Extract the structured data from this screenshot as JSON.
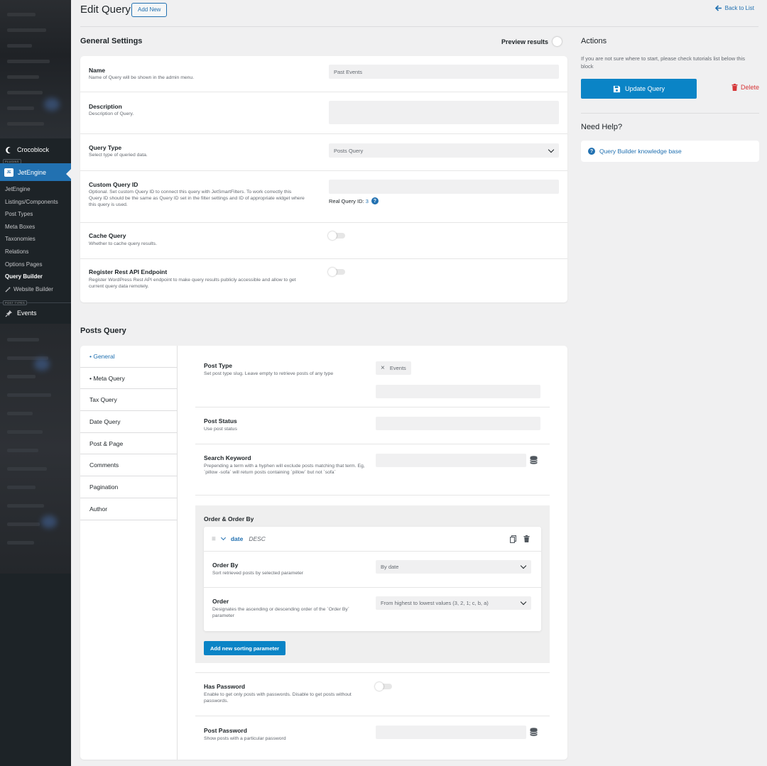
{
  "sidebar": {
    "plugins_tag": "PLUGINS",
    "crocoblock": "Crocoblock",
    "jetengine": "JetEngine",
    "jetengine_logo": "JE",
    "submenu": [
      "JetEngine",
      "Listings/Components",
      "Post Types",
      "Meta Boxes",
      "Taxonomies",
      "Relations",
      "Options Pages",
      "Query Builder",
      "Website Builder"
    ],
    "post_types_tag": "POST TYPES",
    "events": "Events"
  },
  "header": {
    "title": "Edit Query",
    "add_new": "Add New",
    "back": "Back to List"
  },
  "general": {
    "title": "General Settings",
    "preview_label": "Preview results",
    "fields": {
      "name": {
        "label": "Name",
        "desc": "Name of Query will be shown in the admin menu.",
        "value": "Past Events"
      },
      "description": {
        "label": "Description",
        "desc": "Description of Query.",
        "value": ""
      },
      "query_type": {
        "label": "Query Type",
        "desc": "Select type of queried data.",
        "value": "Posts Query"
      },
      "custom_id": {
        "label": "Custom Query ID",
        "desc": "Optional. Set custom Query ID to connect this query with JetSmartFilters. To work correctly this Query ID should be the same as Query ID set in the filter settings and ID of appropriate widget where this query is used.",
        "real_label": "Real Query ID:",
        "real_value": "3"
      },
      "cache": {
        "label": "Cache Query",
        "desc": "Whether to cache query results."
      },
      "rest": {
        "label": "Register Rest API Endpoint",
        "desc": "Register WordPress Rest API endpoint to make query results publicly accessible and allow to get current query data remotely."
      }
    }
  },
  "actions": {
    "title": "Actions",
    "desc": "If you are not sure where to start, please check tutorials list below this block",
    "update": "Update Query",
    "delete": "Delete"
  },
  "help": {
    "title": "Need Help?",
    "link": "Query Builder knowledge base"
  },
  "posts_query": {
    "title": "Posts Query",
    "tabs": [
      "• General",
      "• Meta Query",
      "Tax Query",
      "Date Query",
      "Post & Page",
      "Comments",
      "Pagination",
      "Author"
    ],
    "post_type": {
      "label": "Post Type",
      "desc": "Set post type slug. Leave empty to retrieve posts of any type",
      "chip": "Events"
    },
    "post_status": {
      "label": "Post Status",
      "desc": "Use post status"
    },
    "search": {
      "label": "Search Keyword",
      "desc": "Prepending a term with a hyphen will exclude posts matching that term. Eg, `pillow -sofa` will return posts containing `pillow` but not `sofa`"
    },
    "order": {
      "title": "Order & Order By",
      "item_name": "date",
      "item_dir": "DESC",
      "orderby_label": "Order By",
      "orderby_desc": "Sort retrieved posts by selected parameter",
      "orderby_value": "By date",
      "order_label": "Order",
      "order_desc": "Designates the ascending or descending order of the `Order By` parameter",
      "order_value": "From highest to lowest values (3, 2, 1; c, b, a)",
      "add_button": "Add new sorting parameter"
    },
    "has_password": {
      "label": "Has Password",
      "desc": "Enable to get only posts with passwords. Disable to get posts without passwords."
    },
    "post_password": {
      "label": "Post Password",
      "desc": "Show posts with a particular password"
    }
  }
}
